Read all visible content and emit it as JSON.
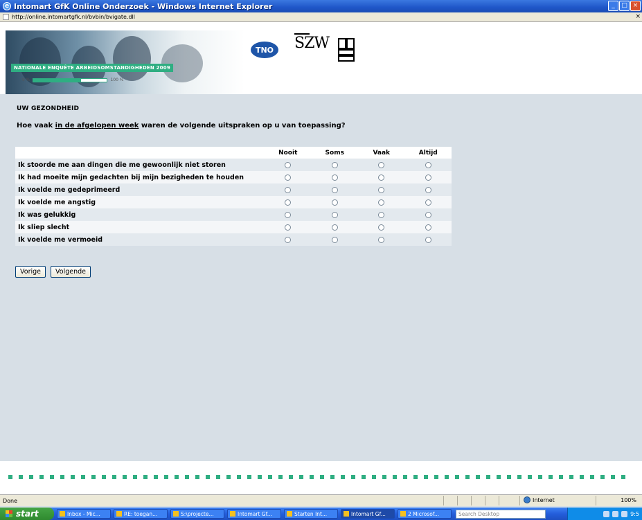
{
  "window": {
    "title": "Intomart GfK Online Onderzoek - Windows Internet Explorer",
    "address": "http://online.intomartgfk.nl/bvbin/bvigate.dll"
  },
  "header": {
    "banner_title": "NATIONALE ENQUÊTE ARBEIDSOMSTANDIGHEDEN 2009",
    "logos": [
      "TNO",
      "SZW",
      "cbs"
    ],
    "progress": {
      "start_label": "0 %",
      "end_label": "100 %",
      "value": 0.65
    }
  },
  "survey": {
    "section_title": "UW GEZONDHEID",
    "question_before": "Hoe vaak ",
    "question_underlined": "in de afgelopen week",
    "question_after": " waren de volgende uitspraken op u van toepassing?",
    "columns": [
      "Nooit",
      "Soms",
      "Vaak",
      "Altijd"
    ],
    "rows": [
      "Ik stoorde me aan dingen die me gewoonlijk niet storen",
      "Ik had moeite mijn gedachten bij mijn bezigheden te houden",
      "Ik voelde me gedeprimeerd",
      "Ik voelde me angstig",
      "Ik was gelukkig",
      "Ik sliep slecht",
      "Ik voelde me vermoeid"
    ],
    "prev_label": "Vorige",
    "next_label": "Volgende"
  },
  "statusbar": {
    "status": "Done",
    "zone": "Internet",
    "zoom": "100%"
  },
  "taskbar": {
    "start_label": "start",
    "tasks": [
      "Inbox - Mic...",
      "RE: toegan...",
      "S:\\projecte...",
      "Intomart Gf...",
      "Starten Int...",
      "Intomart Gf...",
      "2 Microsof..."
    ],
    "search_placeholder": "Search Desktop",
    "clock": "9:5"
  },
  "colors": {
    "accent": "#2fae82",
    "page_bg": "#d7dfe6",
    "titlebar": "#245edb"
  }
}
